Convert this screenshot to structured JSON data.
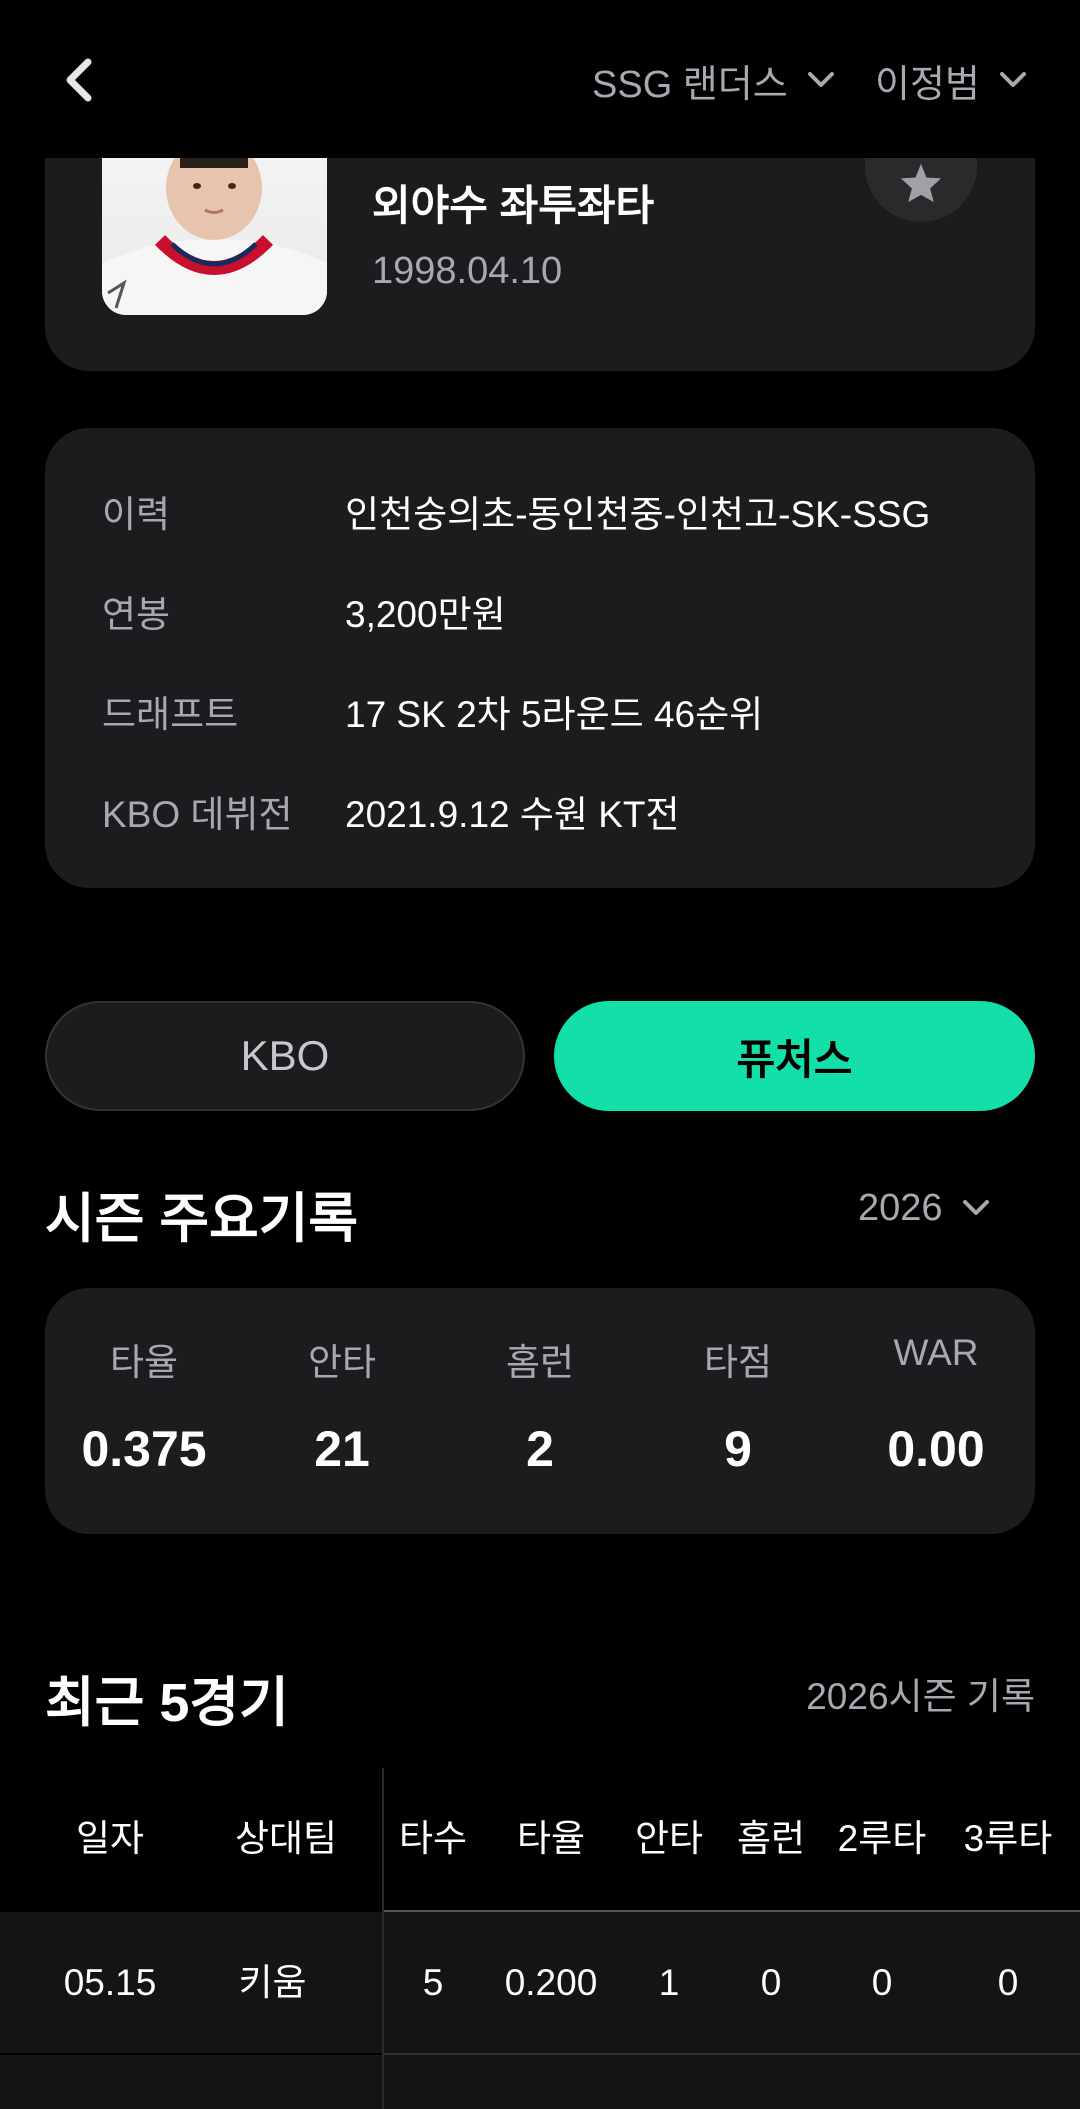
{
  "header": {
    "team": "SSG 랜더스",
    "player": "이정범"
  },
  "profile": {
    "position": "외야수 좌투좌타",
    "birth": "1998.04.10"
  },
  "info": [
    {
      "label": "이력",
      "value": "인천숭의초-동인천중-인천고-SK-SSG"
    },
    {
      "label": "연봉",
      "value": "3,200만원"
    },
    {
      "label": "드래프트",
      "value": "17 SK 2차 5라운드 46순위"
    },
    {
      "label": "KBO 데뷔전",
      "value": "2021.9.12 수원 KT전"
    }
  ],
  "toggle": {
    "kbo": "KBO",
    "futures": "퓨처스",
    "active": "futures",
    "accent": "#13e0a8"
  },
  "season": {
    "title": "시즌 주요기록",
    "year": "2026",
    "stats": [
      {
        "label": "타율",
        "value": "0.375"
      },
      {
        "label": "안타",
        "value": "21"
      },
      {
        "label": "홈런",
        "value": "2"
      },
      {
        "label": "타점",
        "value": "9"
      },
      {
        "label": "WAR",
        "value": "0.00"
      }
    ]
  },
  "recent": {
    "title": "최근 5경기",
    "subtitle": "2026시즌 기록",
    "columns": [
      "일자",
      "상대팀",
      "타수",
      "타율",
      "안타",
      "홈런",
      "2루타",
      "3루타"
    ],
    "rows": [
      [
        "05.15",
        "키움",
        "5",
        "0.200",
        "1",
        "0",
        "0",
        "0"
      ]
    ]
  }
}
